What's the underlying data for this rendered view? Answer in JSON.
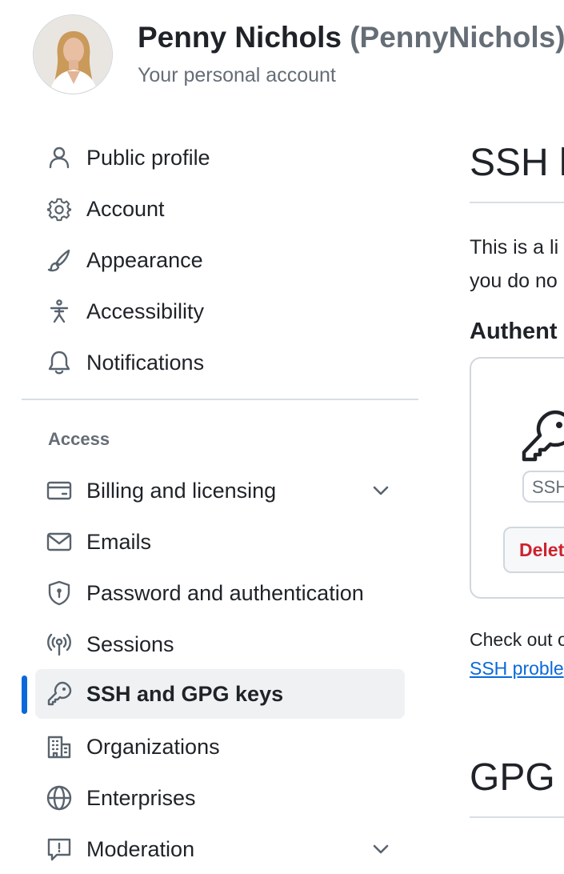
{
  "header": {
    "name": "Penny Nichols",
    "handle": "(PennyNichols)",
    "subtitle": "Your personal account"
  },
  "sidebar": {
    "items": [
      {
        "label": "Public profile",
        "icon": "person-icon"
      },
      {
        "label": "Account",
        "icon": "gear-icon"
      },
      {
        "label": "Appearance",
        "icon": "paintbrush-icon"
      },
      {
        "label": "Accessibility",
        "icon": "accessibility-icon"
      },
      {
        "label": "Notifications",
        "icon": "bell-icon"
      }
    ],
    "access_section": {
      "label": "Access",
      "items": [
        {
          "label": "Billing and licensing",
          "icon": "credit-card-icon",
          "expandable": true
        },
        {
          "label": "Emails",
          "icon": "mail-icon"
        },
        {
          "label": "Password and authentication",
          "icon": "shield-lock-icon"
        },
        {
          "label": "Sessions",
          "icon": "broadcast-icon"
        },
        {
          "label": "SSH and GPG keys",
          "icon": "key-icon",
          "active": true
        },
        {
          "label": "Organizations",
          "icon": "organization-icon"
        },
        {
          "label": "Enterprises",
          "icon": "globe-icon"
        },
        {
          "label": "Moderation",
          "icon": "report-icon",
          "expandable": true
        }
      ]
    },
    "accent_color": "#0969da"
  },
  "main": {
    "ssh_heading": "SSH k",
    "intro_line1": "This is a li",
    "intro_line2": "you do no",
    "auth_heading": "Authent",
    "key_badge": "SSH",
    "delete_label": "Delet",
    "checkout_text": "Check out o",
    "ssh_link": "SSH proble",
    "gpg_heading": "GPG k",
    "danger_color": "#cf222e"
  }
}
